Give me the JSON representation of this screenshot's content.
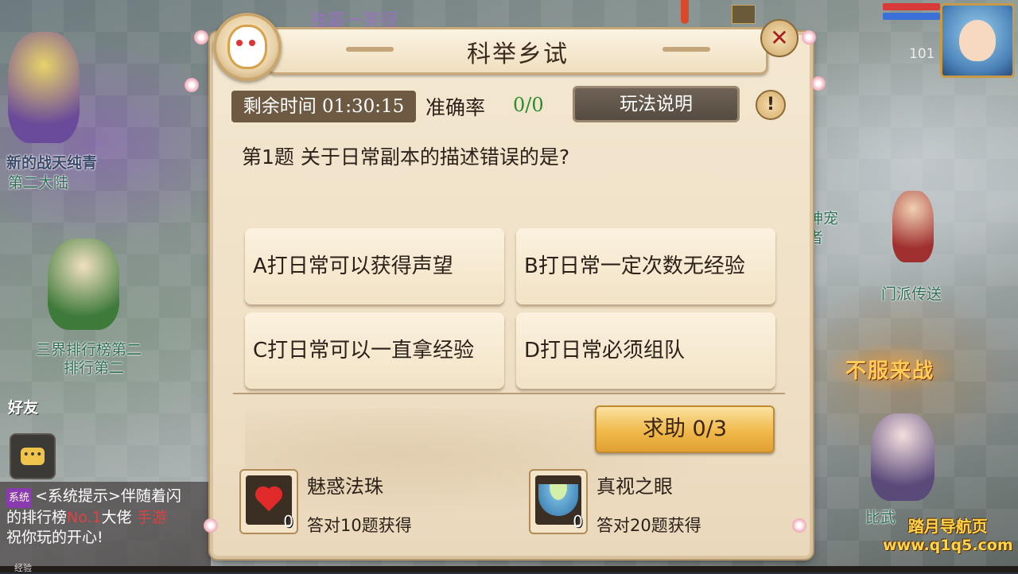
{
  "panel": {
    "title": "科举乡试",
    "close_symbol": "✕",
    "timer_label": "剩余时间 01:30:15",
    "accuracy_label": "准确率",
    "accuracy_value": "0/0",
    "rules_button": "玩法说明",
    "info_symbol": "!",
    "question": "第1题  关于日常副本的描述错误的是?",
    "options": [
      {
        "label": "A打日常可以获得声望"
      },
      {
        "label": "B打日常一定次数无经验"
      },
      {
        "label": "C打日常可以一直拿经验"
      },
      {
        "label": "D打日常必须组队"
      }
    ],
    "help_button": "求助  0/3",
    "rewards": [
      {
        "name": "魅惑法珠",
        "desc": "答对10题获得",
        "count": "0",
        "icon": "heart-icon"
      },
      {
        "name": "真视之眼",
        "desc": "答对20题获得",
        "count": "0",
        "icon": "bowl-icon"
      }
    ]
  },
  "scene": {
    "labels": {
      "npc1_name": "新的战天纯青",
      "npc1_title": "第二大陆",
      "npc2_title": "三界排行榜第二",
      "npc2_name": "排行第二",
      "friend": "好友",
      "right_npc1": "门派传送",
      "right_npc2": "比武",
      "right_npc3": "神宠",
      "right_npc4": "者",
      "fight_banner": "不服来战",
      "top_banner": "独霸一笑很"
    }
  },
  "chat": {
    "tag": "系统",
    "line1": "<系统提示>伴随着闪",
    "line2_pre": "的排行榜",
    "line2_hl": "No.1",
    "line2_post": "大佬",
    "line2_hl2": "手游",
    "line3": "祝你玩的开心!",
    "exp_label": "经验"
  },
  "hud": {
    "level": "101"
  },
  "watermark": {
    "line1": "踏月导航页",
    "line2": "www.q1q5.com"
  },
  "colors": {
    "panel_bg": "#f2e4c9",
    "accent_gold": "#f0b94a",
    "accuracy_green": "#2f8b2f",
    "hp_red": "#d83a3a",
    "mp_blue": "#3a70d8"
  }
}
